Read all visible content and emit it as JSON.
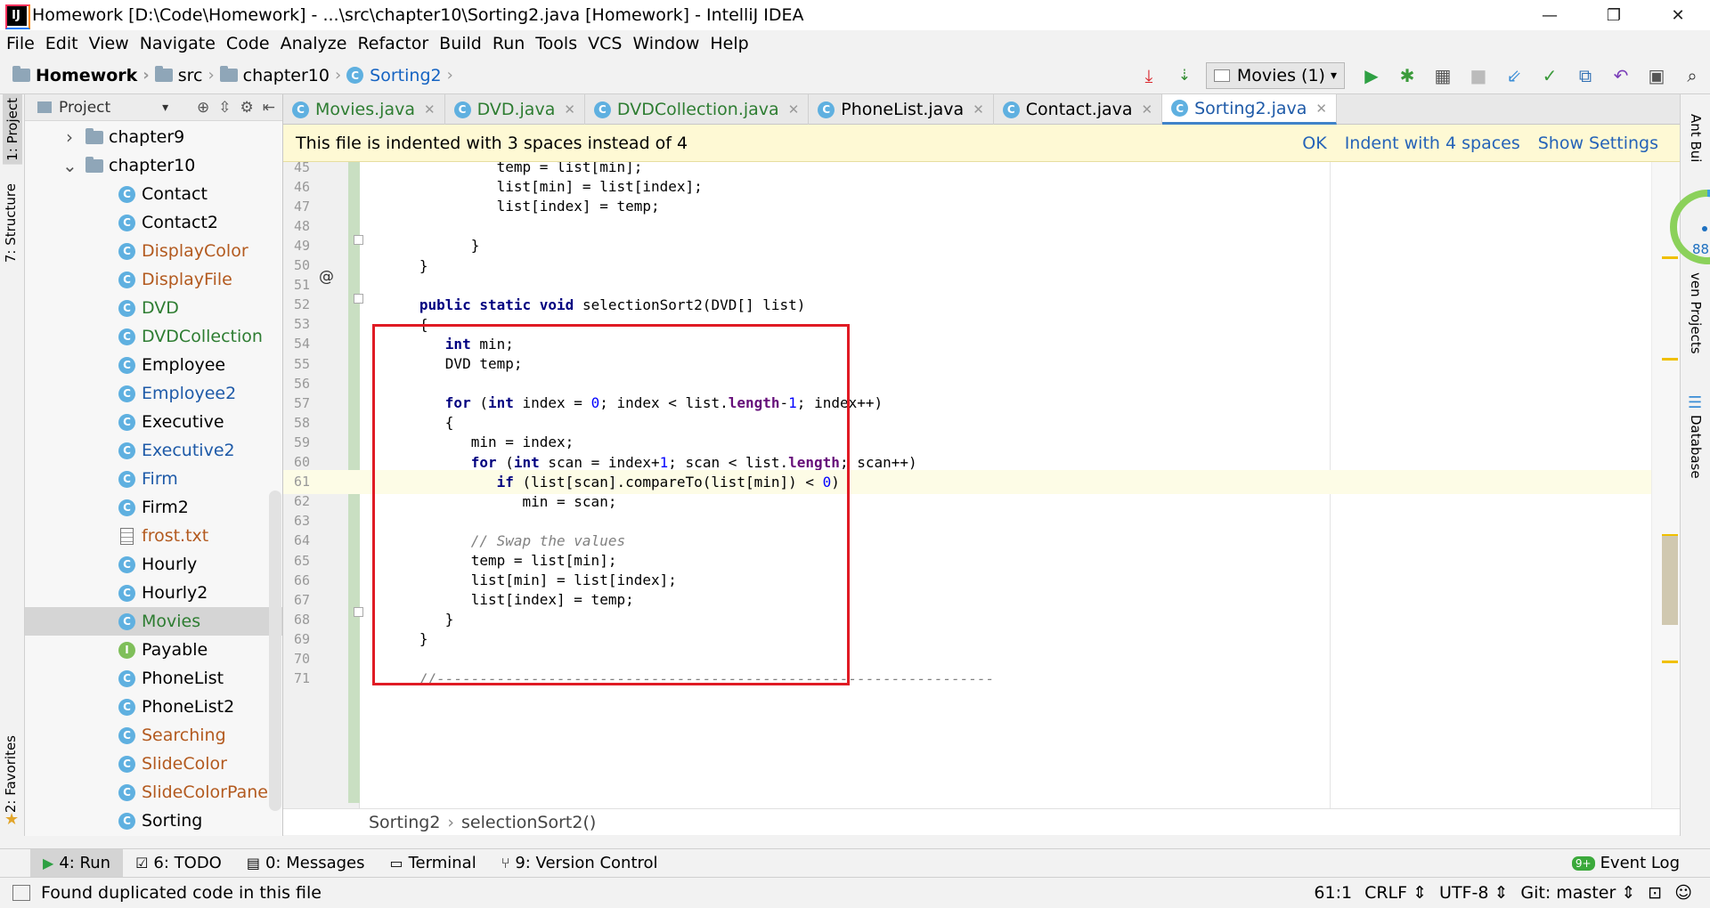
{
  "window": {
    "title": "Homework [D:\\Code\\Homework] - ...\\src\\chapter10\\Sorting2.java [Homework] - IntelliJ IDEA",
    "logo": "IJ",
    "minimize": "—",
    "restore": "❐",
    "close": "✕"
  },
  "menu": [
    "File",
    "Edit",
    "View",
    "Navigate",
    "Code",
    "Analyze",
    "Refactor",
    "Build",
    "Run",
    "Tools",
    "VCS",
    "Window",
    "Help"
  ],
  "breadcrumb": {
    "project": "Homework",
    "src": "src",
    "package": "chapter10",
    "file": "Sorting2"
  },
  "toolbar": {
    "run_config": "Movies (1)"
  },
  "left_tabs": {
    "project": "1: Project",
    "structure": "7: Structure",
    "favorites": "2: Favorites"
  },
  "right_tabs": {
    "ant": "Ant Bui",
    "maven": "ven Projects",
    "database": "Database"
  },
  "gauge": {
    "value": 0.88,
    "label": "88%"
  },
  "project_panel": {
    "title": "Project",
    "folders": [
      {
        "name": "chapter9",
        "expanded": false
      },
      {
        "name": "chapter10",
        "expanded": true
      }
    ],
    "files": [
      {
        "name": "Contact",
        "icon": "class",
        "color": "default"
      },
      {
        "name": "Contact2",
        "icon": "class",
        "color": "default"
      },
      {
        "name": "DisplayColor",
        "icon": "class-runnable",
        "color": "orange"
      },
      {
        "name": "DisplayFile",
        "icon": "class-runnable",
        "color": "orange"
      },
      {
        "name": "DVD",
        "icon": "class",
        "color": "green"
      },
      {
        "name": "DVDCollection",
        "icon": "class",
        "color": "green"
      },
      {
        "name": "Employee",
        "icon": "class",
        "color": "default"
      },
      {
        "name": "Employee2",
        "icon": "class-abstract",
        "color": "blue"
      },
      {
        "name": "Executive",
        "icon": "class",
        "color": "default"
      },
      {
        "name": "Executive2",
        "icon": "class-abstract",
        "color": "blue"
      },
      {
        "name": "Firm",
        "icon": "class-runnable",
        "color": "blue"
      },
      {
        "name": "Firm2",
        "icon": "class-runnable",
        "color": "default"
      },
      {
        "name": "frost.txt",
        "icon": "text-file",
        "color": "orange"
      },
      {
        "name": "Hourly",
        "icon": "class",
        "color": "default"
      },
      {
        "name": "Hourly2",
        "icon": "class-abstract",
        "color": "default"
      },
      {
        "name": "Movies",
        "icon": "class-runnable",
        "color": "green",
        "selected": true
      },
      {
        "name": "Payable",
        "icon": "interface",
        "color": "default"
      },
      {
        "name": "PhoneList",
        "icon": "class-runnable",
        "color": "default"
      },
      {
        "name": "PhoneList2",
        "icon": "class-runnable",
        "color": "default"
      },
      {
        "name": "Searching",
        "icon": "class",
        "color": "orange"
      },
      {
        "name": "SlideColor",
        "icon": "class-runnable",
        "color": "orange"
      },
      {
        "name": "SlideColorPanel",
        "icon": "class",
        "color": "orange"
      },
      {
        "name": "Sorting",
        "icon": "class",
        "color": "default"
      }
    ]
  },
  "tabs": [
    {
      "label": "Movies.java",
      "color": "green",
      "active": false
    },
    {
      "label": "DVD.java",
      "color": "green",
      "active": false
    },
    {
      "label": "DVDCollection.java",
      "color": "green",
      "active": false
    },
    {
      "label": "PhoneList.java",
      "color": "black",
      "active": false
    },
    {
      "label": "Contact.java",
      "color": "black",
      "active": false
    },
    {
      "label": "Sorting2.java",
      "color": "blue",
      "active": true
    }
  ],
  "notice": {
    "message": "This file is indented with 3 spaces instead of 4",
    "ok": "OK",
    "indent": "Indent with 4 spaces",
    "settings": "Show Settings"
  },
  "code_lines": [
    {
      "n": "45",
      "text": "            temp = list[min];"
    },
    {
      "n": "46",
      "text": "            list[min] = list[index];"
    },
    {
      "n": "47",
      "text": "            list[index] = temp;"
    },
    {
      "n": "48",
      "text": ""
    },
    {
      "n": "49",
      "text": "         }"
    },
    {
      "n": "50",
      "text": "   }"
    },
    {
      "n": "51",
      "text": ""
    },
    {
      "n": "52",
      "text": "   public static void selectionSort2(DVD[] list)"
    },
    {
      "n": "53",
      "text": "   {"
    },
    {
      "n": "54",
      "text": "      int min;"
    },
    {
      "n": "55",
      "text": "      DVD temp;"
    },
    {
      "n": "56",
      "text": ""
    },
    {
      "n": "57",
      "text": "      for (int index = 0; index < list.length-1; index++)"
    },
    {
      "n": "58",
      "text": "      {"
    },
    {
      "n": "59",
      "text": "         min = index;"
    },
    {
      "n": "60",
      "text": "         for (int scan = index+1; scan < list.length; scan++)"
    },
    {
      "n": "61",
      "text": "            if (list[scan].compareTo(list[min]) < 0)"
    },
    {
      "n": "62",
      "text": "               min = scan;"
    },
    {
      "n": "63",
      "text": ""
    },
    {
      "n": "64",
      "text": "         // Swap the values"
    },
    {
      "n": "65",
      "text": "         temp = list[min];"
    },
    {
      "n": "66",
      "text": "         list[min] = list[index];"
    },
    {
      "n": "67",
      "text": "         list[index] = temp;"
    },
    {
      "n": "68",
      "text": "      }"
    },
    {
      "n": "69",
      "text": "   }"
    },
    {
      "n": "70",
      "text": ""
    },
    {
      "n": "71",
      "text": "   //-----------------------------------------------------------------"
    }
  ],
  "current_line": "61",
  "editor_breadcrumb": [
    "Sorting2",
    "selectionSort2()"
  ],
  "tool_windows": [
    {
      "label": "4: Run",
      "icon": "▶",
      "active": true
    },
    {
      "label": "6: TODO",
      "icon": "☑",
      "active": false
    },
    {
      "label": "0: Messages",
      "icon": "▤",
      "active": false
    },
    {
      "label": "Terminal",
      "icon": "▭",
      "active": false
    },
    {
      "label": "9: Version Control",
      "icon": "⑂",
      "active": false
    }
  ],
  "event_log": {
    "badge": "9+",
    "label": "Event Log"
  },
  "status": {
    "message": "Found duplicated code in this file",
    "position": "61:1",
    "line_sep": "CRLF",
    "encoding": "UTF-8",
    "git": "Git: master"
  },
  "colors": {
    "accent": "#4083c9",
    "highlight_box": "#e01b24",
    "notice_bg": "#fef9d4"
  }
}
